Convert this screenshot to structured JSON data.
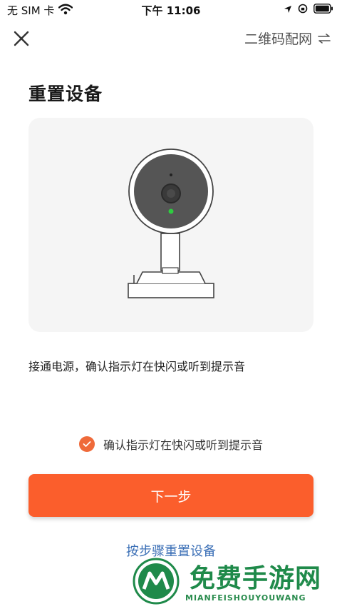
{
  "status_bar": {
    "carrier": "无 SIM 卡",
    "time": "下午 11:06"
  },
  "nav": {
    "mode_label": "二维码配网"
  },
  "page": {
    "title": "重置设备",
    "instruction": "接通电源，确认指示灯在快闪或听到提示音"
  },
  "confirm": {
    "checked": true,
    "label": "确认指示灯在快闪或听到提示音"
  },
  "actions": {
    "next_label": "下一步",
    "reset_link": "按步骤重置设备"
  },
  "watermark": {
    "title": "免费手游网",
    "subtitle": "MIANFEISHOUYOUWANG"
  },
  "colors": {
    "accent": "#fb5e2c",
    "link": "#3b6fb6",
    "indicator": "#2ecc40",
    "watermark": "#1f8a4a"
  }
}
